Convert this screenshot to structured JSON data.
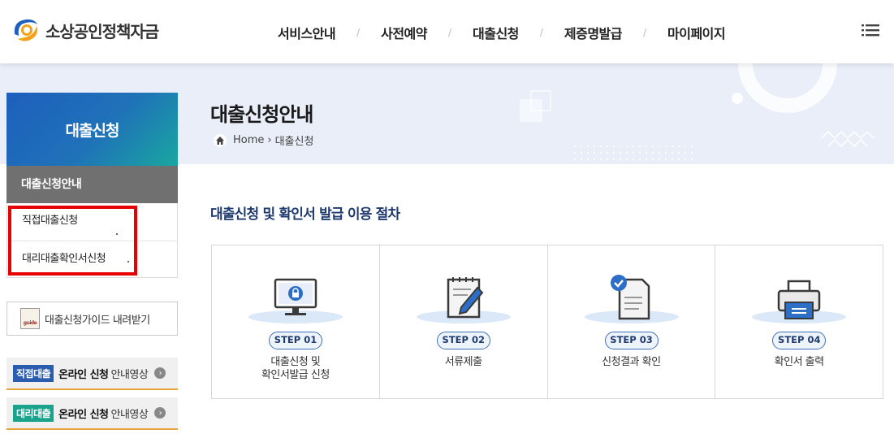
{
  "header": {
    "logo_text": "소상공인정책자금",
    "nav": [
      "서비스안내",
      "사전예약",
      "대출신청",
      "제증명발급",
      "마이페이지"
    ],
    "nav_separator": "/"
  },
  "banner": {
    "title": "대출신청안내",
    "breadcrumb_home": "Home",
    "breadcrumb_sep": "›",
    "breadcrumb_current": "대출신청"
  },
  "sidebar": {
    "title": "대출신청",
    "active_item": "대출신청안내",
    "sub_items": [
      "직접대출신청",
      "대리대출확인서신청"
    ],
    "guide_label": "대출신청가이드 내려받기",
    "guide_icon_text": "guide",
    "videos": [
      {
        "tag": "직접대출",
        "strong": "온라인 신청",
        "rest": "안내영상",
        "tag_color": "#2a5db0"
      },
      {
        "tag": "대리대출",
        "strong": "온라인 신청",
        "rest": "안내영상",
        "tag_color": "#1aa38c"
      }
    ]
  },
  "main": {
    "section_title": "대출신청 및 확인서 발급 이용 절차",
    "steps": [
      {
        "badge": "STEP 01",
        "text": "대출신청 및\n확인서발급 신청",
        "icon": "monitor-lock-icon"
      },
      {
        "badge": "STEP 02",
        "text": "서류제출",
        "icon": "document-pen-icon"
      },
      {
        "badge": "STEP 03",
        "text": "신청결과 확인",
        "icon": "document-check-icon"
      },
      {
        "badge": "STEP 04",
        "text": "확인서 출력",
        "icon": "printer-icon"
      }
    ]
  },
  "colors": {
    "accent_blue": "#1e5fbd",
    "accent_teal": "#19a7a0",
    "highlight_red": "#e60000",
    "banner_bg": "#e9eef8"
  }
}
